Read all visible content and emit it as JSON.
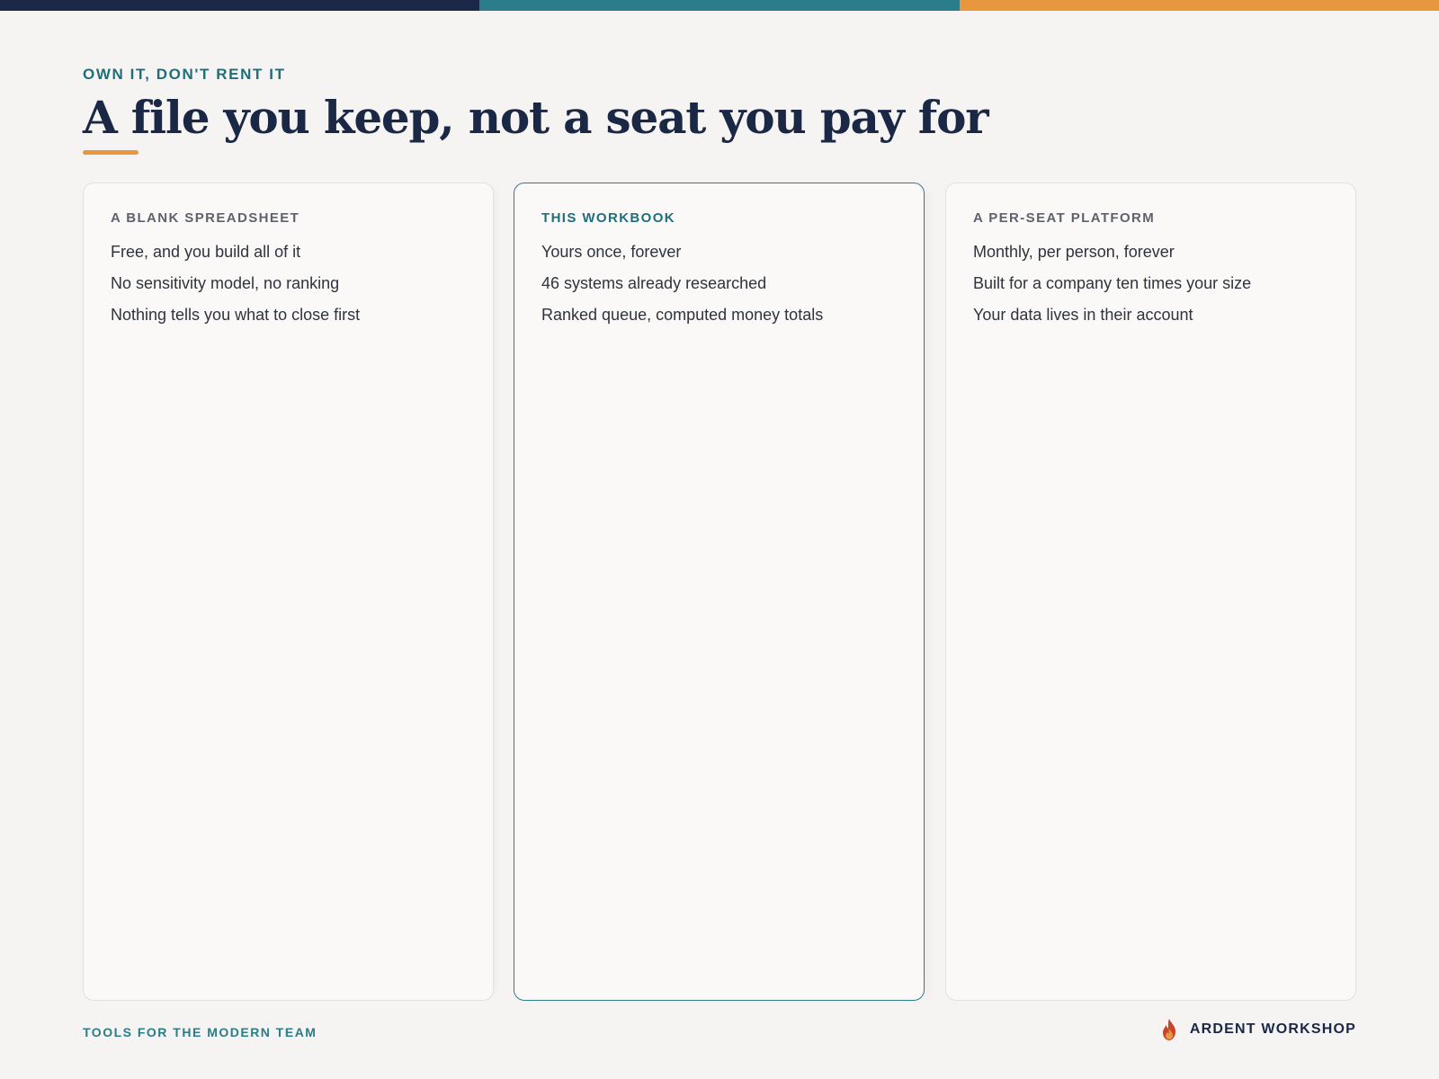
{
  "colors": {
    "navy": "#1c2847",
    "teal": "#2b7d8b",
    "orange": "#e8973f",
    "background": "#f5f4f2"
  },
  "header": {
    "eyebrow": "OWN IT, DON'T RENT IT",
    "title": "A file you keep, not a seat you pay for"
  },
  "cards": [
    {
      "title": "A BLANK SPREADSHEET",
      "lines": [
        "Free, and you build all of it",
        "No sensitivity model, no ranking",
        "Nothing tells you what to close first"
      ]
    },
    {
      "title": "THIS WORKBOOK",
      "lines": [
        "Yours once, forever",
        "46 systems already researched",
        "Ranked queue, computed money totals"
      ]
    },
    {
      "title": "A PER-SEAT PLATFORM",
      "lines": [
        "Monthly, per person, forever",
        "Built for a company ten times your size",
        "Your data lives in their account"
      ]
    }
  ],
  "footer": {
    "tagline": "TOOLS FOR THE MODERN TEAM",
    "brand": "ARDENT WORKSHOP",
    "brand_icon": "flame-icon"
  }
}
